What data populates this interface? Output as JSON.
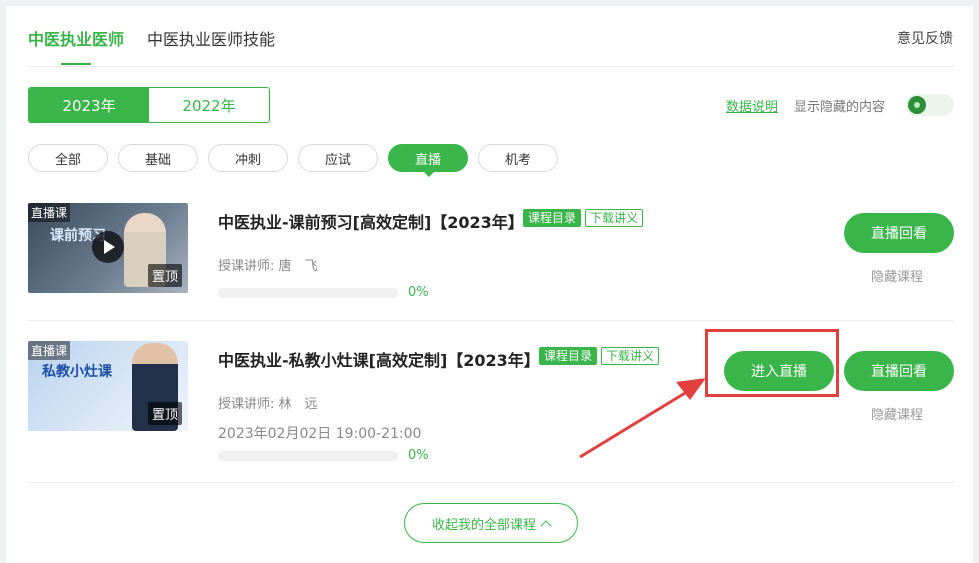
{
  "header": {
    "tabs": [
      {
        "label": "中医执业医师",
        "active": true
      },
      {
        "label": "中医执业医师技能",
        "active": false
      }
    ],
    "feedback": "意见反馈"
  },
  "years": [
    {
      "label": "2023年",
      "active": true
    },
    {
      "label": "2022年",
      "active": false
    }
  ],
  "toolbar": {
    "data_link": "数据说明",
    "show_hidden": "显示隐藏的内容"
  },
  "filters": [
    {
      "label": "全部",
      "active": false
    },
    {
      "label": "基础",
      "active": false
    },
    {
      "label": "冲刺",
      "active": false
    },
    {
      "label": "应试",
      "active": false
    },
    {
      "label": "直播",
      "active": true
    },
    {
      "label": "机考",
      "active": false
    }
  ],
  "courses": [
    {
      "thumb_tag": "直播课",
      "thumb_title": "课前预习",
      "pin": "置顶",
      "title": "中医执业-课前预习[高效定制]【2023年】",
      "tag_catalog": "课程目录",
      "tag_download": "下载讲义",
      "teacher": "授课讲师:  唐　飞",
      "progress": 0,
      "progress_label": "0%",
      "replay_button": "直播回看",
      "hide": "隐藏课程"
    },
    {
      "thumb_tag": "直播课",
      "thumb_title": "私教小灶课",
      "pin": "置顶",
      "title": "中医执业-私教小灶课[高效定制]【2023年】",
      "tag_catalog": "课程目录",
      "tag_download": "下载讲义",
      "teacher": "授课讲师:  林　远",
      "time": "2023年02月02日 19:00-21:00",
      "progress": 0,
      "progress_label": "0%",
      "enter_button": "进入直播",
      "replay_button": "直播回看",
      "hide": "隐藏课程"
    }
  ],
  "collapse": "收起我的全部课程",
  "colors": {
    "accent": "#39b54a",
    "annotation": "#e2403f"
  }
}
